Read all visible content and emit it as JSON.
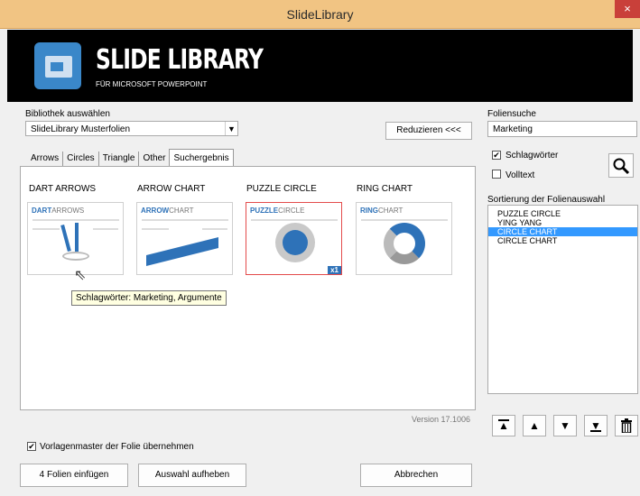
{
  "window": {
    "title": "SlideLibrary",
    "close_label": "×"
  },
  "banner": {
    "brand": "SLIDE LIBRARY",
    "subtitle": "FÜR MICROSOFT POWERPOINT"
  },
  "library": {
    "label": "Bibliothek auswählen",
    "selected": "SlideLibrary Musterfolien",
    "reduce_button": "Reduzieren <<<"
  },
  "tabs": [
    "Arrows",
    "Circles",
    "Triangle",
    "Other",
    "Suchergebnis"
  ],
  "slides": [
    {
      "title": "DART ARROWS",
      "thumb_bold": "DART",
      "thumb_light": "ARROWS"
    },
    {
      "title": "ARROW CHART",
      "thumb_bold": "ARROW",
      "thumb_light": "CHART"
    },
    {
      "title": "PUZZLE CIRCLE",
      "thumb_bold": "PUZZLE",
      "thumb_light": "CIRCLE",
      "badge": "x1"
    },
    {
      "title": "RING CHART",
      "thumb_bold": "RING",
      "thumb_light": "CHART"
    }
  ],
  "tooltip": "Schlagwörter: Marketing, Argumente",
  "version": "Version 17.1006",
  "search": {
    "label": "Foliensuche",
    "value": "Marketing",
    "keywords_label": "Schlagwörter",
    "keywords_checked": true,
    "fulltext_label": "Volltext",
    "fulltext_checked": false,
    "button_icon": "magnifier-icon"
  },
  "sort": {
    "label": "Sortierung der Folienauswahl",
    "items": [
      "PUZZLE CIRCLE",
      "YING YANG",
      "CIRCLE CHART",
      "CIRCLE CHART"
    ],
    "selected_index": 2
  },
  "sort_controls": [
    "move-top-icon",
    "move-up-icon",
    "move-down-icon",
    "move-bottom-icon",
    "trash-icon"
  ],
  "master": {
    "label": "Vorlagenmaster der Folie übernehmen",
    "checked": true
  },
  "footer": {
    "insert": "4 Folien einfügen",
    "clear": "Auswahl aufheben",
    "cancel": "Abbrechen"
  }
}
